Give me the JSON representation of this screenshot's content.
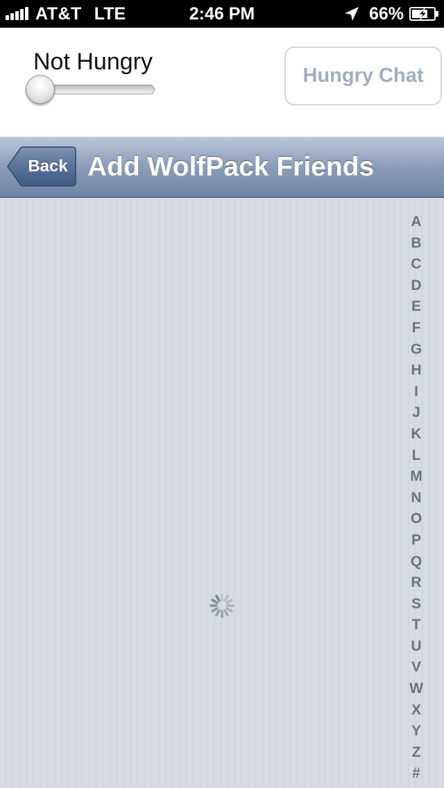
{
  "status_bar": {
    "carrier": "AT&T",
    "network": "LTE",
    "time": "2:46 PM",
    "battery": "66%",
    "signal_icon": "signal-bars-icon",
    "location_icon": "location-arrow-icon",
    "battery_icon": "battery-charging-icon"
  },
  "header_panel": {
    "hunger_label": "Not Hungry",
    "hunger_slider_value": 0,
    "chat_button": "Hungry Chat"
  },
  "nav_bar": {
    "back_label": "Back",
    "title": "Add WolfPack Friends"
  },
  "section_index": [
    "A",
    "B",
    "C",
    "D",
    "E",
    "F",
    "G",
    "H",
    "I",
    "J",
    "K",
    "L",
    "M",
    "N",
    "O",
    "P",
    "Q",
    "R",
    "S",
    "T",
    "U",
    "V",
    "W",
    "X",
    "Y",
    "Z",
    "#"
  ],
  "loading_icon": "activity-spinner-icon",
  "colors": {
    "nav_bar": "#8ea0ba",
    "list_background": "#d6dbe4",
    "index_text": "#6a7284",
    "chat_button_text": "#a2adc1"
  }
}
